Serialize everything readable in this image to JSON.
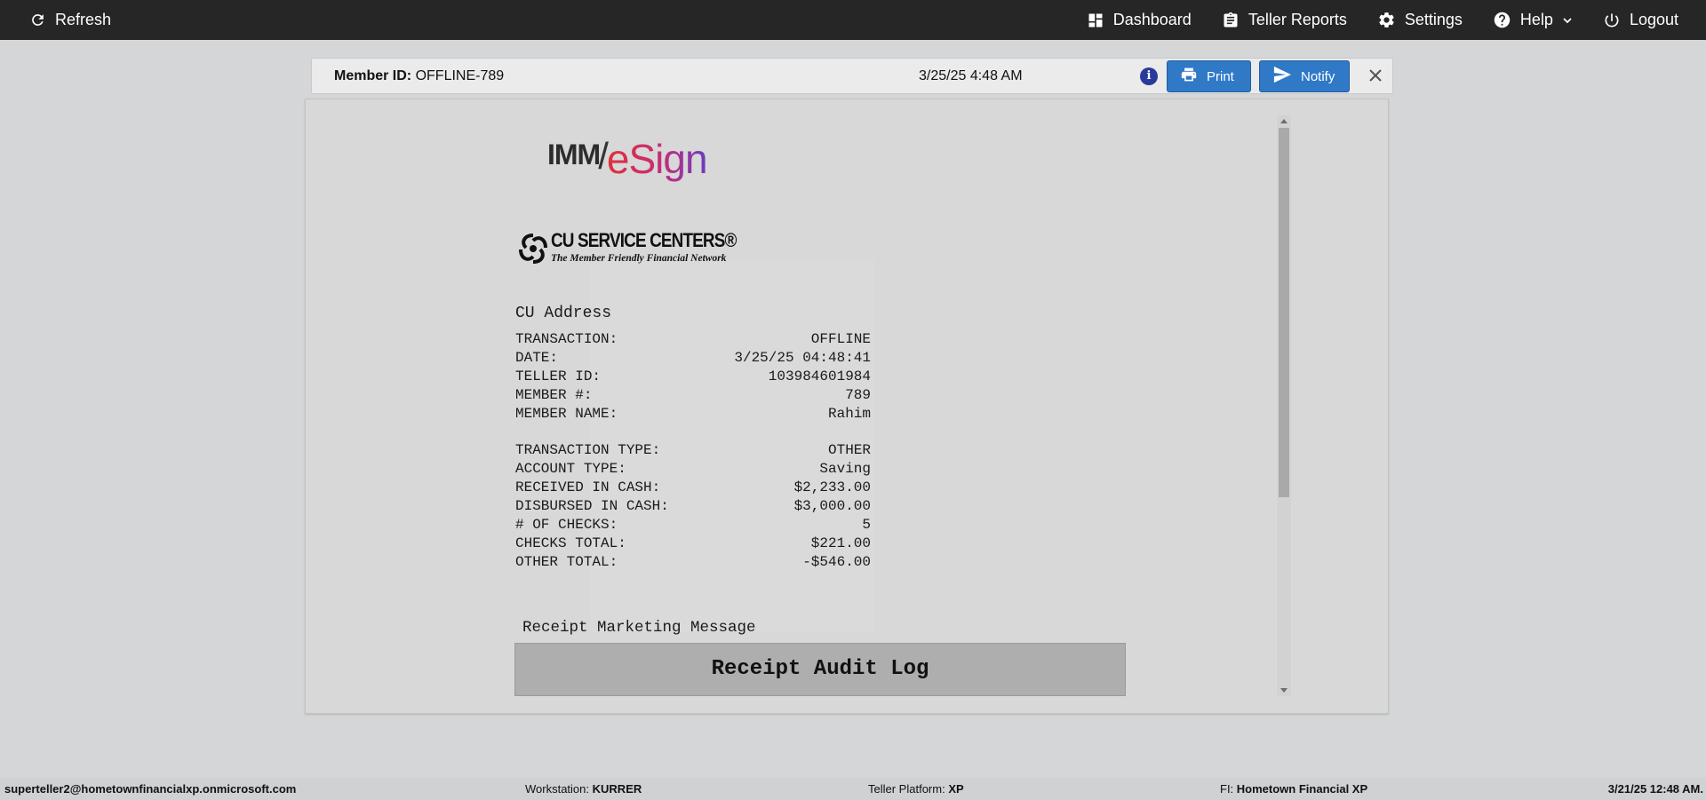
{
  "topbar": {
    "refresh_label": "Refresh",
    "dashboard_label": "Dashboard",
    "teller_reports_label": "Teller Reports",
    "settings_label": "Settings",
    "help_label": "Help",
    "logout_label": "Logout"
  },
  "header": {
    "member_id_label": "Member ID:",
    "member_id_value": "OFFLINE-789",
    "datetime": "3/25/25 4:48 AM",
    "print_label": "Print",
    "notify_label": "Notify"
  },
  "receipt": {
    "logo_imm": "IMM",
    "logo_slash": "/",
    "logo_esign": "eSign",
    "cu_name": "CU SERVICE CENTERS®",
    "cu_tagline": "The Member Friendly Financial Network",
    "address": "CU Address",
    "section1": [
      {
        "label": "TRANSACTION:",
        "value": "OFFLINE"
      },
      {
        "label": "DATE:",
        "value": "3/25/25 04:48:41"
      },
      {
        "label": "TELLER ID:",
        "value": "103984601984"
      },
      {
        "label": "MEMBER #:",
        "value": "789"
      },
      {
        "label": "MEMBER NAME:",
        "value": "Rahim"
      }
    ],
    "section2": [
      {
        "label": "TRANSACTION TYPE:",
        "value": "OTHER"
      },
      {
        "label": "ACCOUNT TYPE:",
        "value": "Saving"
      },
      {
        "label": "RECEIVED IN CASH:",
        "value": "$2,233.00"
      },
      {
        "label": "DISBURSED IN CASH:",
        "value": "$3,000.00"
      },
      {
        "label": "# OF CHECKS:",
        "value": "5"
      },
      {
        "label": "CHECKS TOTAL:",
        "value": "$221.00"
      },
      {
        "label": "OTHER TOTAL:",
        "value": "-$546.00"
      }
    ],
    "marketing_message": "Receipt Marketing Message",
    "audit_log_title": "Receipt Audit Log"
  },
  "statusbar": {
    "user_email": "superteller2@hometownfinancialxp.onmicrosoft.com",
    "workstation_label": "Workstation:",
    "workstation_value": "KURRER",
    "platform_label": "Teller Platform:",
    "platform_value": "XP",
    "fi_label": "FI:",
    "fi_value": "Hometown Financial XP",
    "datetime": "3/21/25 12:48 AM."
  },
  "colors": {
    "topbar_bg": "#262626",
    "button_blue": "#2f79c7",
    "info_icon": "#2a3a9a"
  }
}
